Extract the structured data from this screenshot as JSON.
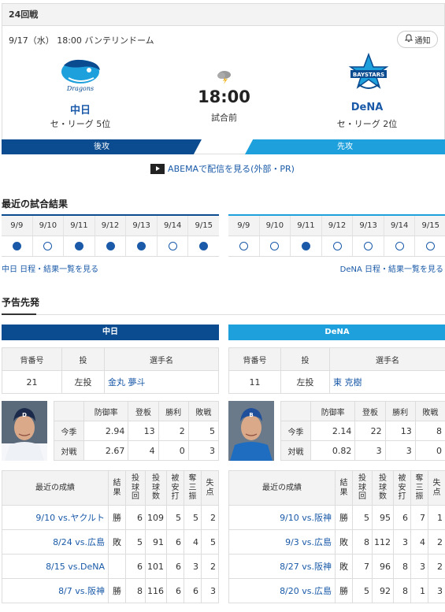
{
  "game": {
    "number": "24回戦",
    "meta": "9/17（水） 18:00 バンテリンドーム",
    "notify": "通知",
    "time": "18:00",
    "status": "試合前",
    "abema": "ABEMAで配信を見る(外部・PR)"
  },
  "home": {
    "name": "中日",
    "rank": "セ・リーグ 5位",
    "side": "後攻",
    "color": "#0b4b8f"
  },
  "away": {
    "name": "DeNA",
    "rank": "セ・リーグ 2位",
    "side": "先攻",
    "color": "#1da0dc"
  },
  "recent_results": {
    "title": "最近の試合結果",
    "home": {
      "dates": [
        "9/9",
        "9/10",
        "9/11",
        "9/12",
        "9/13",
        "9/14",
        "9/15"
      ],
      "results": [
        "win",
        "lose",
        "win",
        "win",
        "win",
        "lose",
        "win"
      ],
      "link": "中日 日程・結果一覧を見る"
    },
    "away": {
      "dates": [
        "9/9",
        "9/10",
        "9/11",
        "9/12",
        "9/13",
        "9/14",
        "9/15"
      ],
      "results": [
        "lose",
        "lose",
        "win",
        "lose",
        "lose",
        "lose",
        "lose"
      ],
      "link": "DeNA 日程・結果一覧を見る"
    }
  },
  "starters": {
    "title": "予告先発",
    "headers": {
      "number": "背番号",
      "throws": "投",
      "name": "選手名"
    },
    "stat_headers": [
      "防御率",
      "登板",
      "勝利",
      "敗戦"
    ],
    "row_labels": {
      "season": "今季",
      "vs": "対戦"
    },
    "recent_headers": {
      "label": "最近の成績",
      "result": "結果",
      "ip": "投球回",
      "pitches": "投球数",
      "hits": "被安打",
      "k": "奪三振",
      "er": "失点"
    },
    "home": {
      "number": "21",
      "throws": "左投",
      "name": "金丸 夢斗",
      "season": [
        "2.94",
        "13",
        "2",
        "5"
      ],
      "vs": [
        "2.67",
        "4",
        "0",
        "3"
      ],
      "recent": [
        {
          "game": "9/10 vs.ヤクルト",
          "result": "勝",
          "ip": "6",
          "pitches": "109",
          "hits": "5",
          "k": "5",
          "er": "2"
        },
        {
          "game": "8/24 vs.広島",
          "result": "敗",
          "ip": "5",
          "pitches": "91",
          "hits": "6",
          "k": "4",
          "er": "5"
        },
        {
          "game": "8/15 vs.DeNA",
          "result": "",
          "ip": "6",
          "pitches": "101",
          "hits": "6",
          "k": "3",
          "er": "2"
        },
        {
          "game": "8/7 vs.阪神",
          "result": "勝",
          "ip": "8",
          "pitches": "116",
          "hits": "6",
          "k": "6",
          "er": "3"
        }
      ]
    },
    "away": {
      "number": "11",
      "throws": "左投",
      "name": "東 克樹",
      "season": [
        "2.14",
        "22",
        "13",
        "8"
      ],
      "vs": [
        "0.82",
        "3",
        "3",
        "0"
      ],
      "recent": [
        {
          "game": "9/10 vs.阪神",
          "result": "勝",
          "ip": "5",
          "pitches": "95",
          "hits": "6",
          "k": "7",
          "er": "1"
        },
        {
          "game": "9/3 vs.広島",
          "result": "敗",
          "ip": "8",
          "pitches": "112",
          "hits": "3",
          "k": "4",
          "er": "2"
        },
        {
          "game": "8/27 vs.阪神",
          "result": "敗",
          "ip": "7",
          "pitches": "96",
          "hits": "8",
          "k": "3",
          "er": "2"
        },
        {
          "game": "8/20 vs.広島",
          "result": "勝",
          "ip": "5",
          "pitches": "92",
          "hits": "8",
          "k": "1",
          "er": "3"
        }
      ]
    }
  }
}
